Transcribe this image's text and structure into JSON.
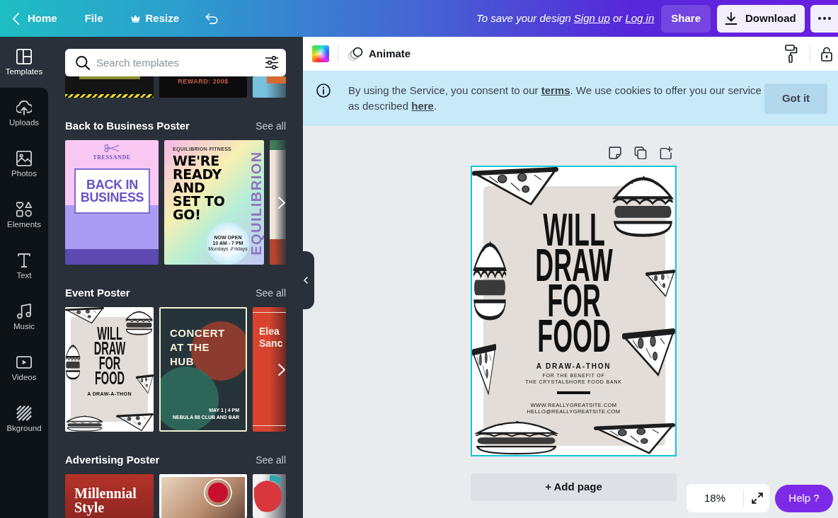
{
  "top_bar": {
    "home": "Home",
    "menus": [
      {
        "label": "File",
        "kind": "plain"
      },
      {
        "label": "Resize",
        "kind": "premium"
      }
    ],
    "save_prompt": [
      {
        "text": "To save your design ",
        "kind": "text"
      },
      {
        "text": "Sign up",
        "kind": "link"
      },
      {
        "text": " or ",
        "kind": "text"
      },
      {
        "text": "Log in",
        "kind": "link"
      }
    ],
    "share": "Share",
    "download": "Download"
  },
  "rail": [
    {
      "label": "Templates",
      "selected": true
    },
    {
      "label": "Uploads",
      "selected": false
    },
    {
      "label": "Photos",
      "selected": false
    },
    {
      "label": "Elements",
      "selected": false
    },
    {
      "label": "Text",
      "selected": false
    },
    {
      "label": "Music",
      "selected": false
    },
    {
      "label": "Videos",
      "selected": false
    },
    {
      "label": "Bkground",
      "selected": false
    }
  ],
  "panel": {
    "search": {
      "placeholder": "Search templates"
    },
    "top_row": [
      {
        "kind": "hazard"
      },
      {
        "kind": "reward",
        "headline": "REWARD: 200$"
      },
      {
        "kind": "sky"
      }
    ],
    "sections": [
      {
        "title": "Back to Business Poster",
        "see_all": "See all",
        "next": true,
        "templates": [
          {
            "kind": "salon",
            "brand": "TRESSANDE",
            "headline": "BACK IN BUSINESS"
          },
          {
            "kind": "fitness",
            "brand": "EQUILIBRION FITNESS",
            "headline": "WE'RE READY AND SET TO GO!",
            "badge": [
              "NOW OPEN",
              "10 AM - 7 PM",
              "Mondays -Fridays"
            ],
            "side_text": "EQUILIBRION"
          },
          {
            "kind": "green"
          }
        ]
      },
      {
        "title": "Event Poster",
        "see_all": "See all",
        "next": true,
        "templates": [
          {
            "kind": "sketch",
            "headline": "WILL DRAW FOR FOOD",
            "subtitle": "A DRAW-A-THON"
          },
          {
            "kind": "concert",
            "headline": "CONCERT AT THE HUB",
            "date": "MAY 1 | 4 PM",
            "venue": "NEBULA 88 CLUB AND BAR"
          },
          {
            "kind": "red",
            "lines": [
              "Elea",
              "Sanc"
            ]
          }
        ]
      },
      {
        "title": "Advertising Poster",
        "see_all": "See all",
        "templates": [
          {
            "kind": "street",
            "headline": "Millennial Style"
          },
          {
            "kind": "sushi"
          },
          {
            "kind": "splash"
          }
        ]
      }
    ]
  },
  "toolbar": {
    "animate": "Animate"
  },
  "notice": {
    "segments": [
      {
        "text": "By using the Service, you consent to our ",
        "kind": "text"
      },
      {
        "text": "terms",
        "kind": "link"
      },
      {
        "text": ". We use cookies to offer you our service as described ",
        "kind": "text"
      },
      {
        "text": "here",
        "kind": "link"
      },
      {
        "text": ".",
        "kind": "text"
      }
    ],
    "button": "Got it"
  },
  "canvas": {
    "design": {
      "selected": true,
      "headline": "WILL DRAW FOR FOOD",
      "subtitle": "A DRAW-A-THON",
      "benefit": [
        "FOR THE BENEFIT OF",
        "THE CRYSTALSHORE FOOD BANK"
      ],
      "contacts": [
        "WWW.REALLYGREATSITE.COM",
        "HELLO@REALLYGREATSITE.COM"
      ]
    },
    "add_page": "+ Add page",
    "zoom": "18%",
    "help": "Help ?"
  }
}
